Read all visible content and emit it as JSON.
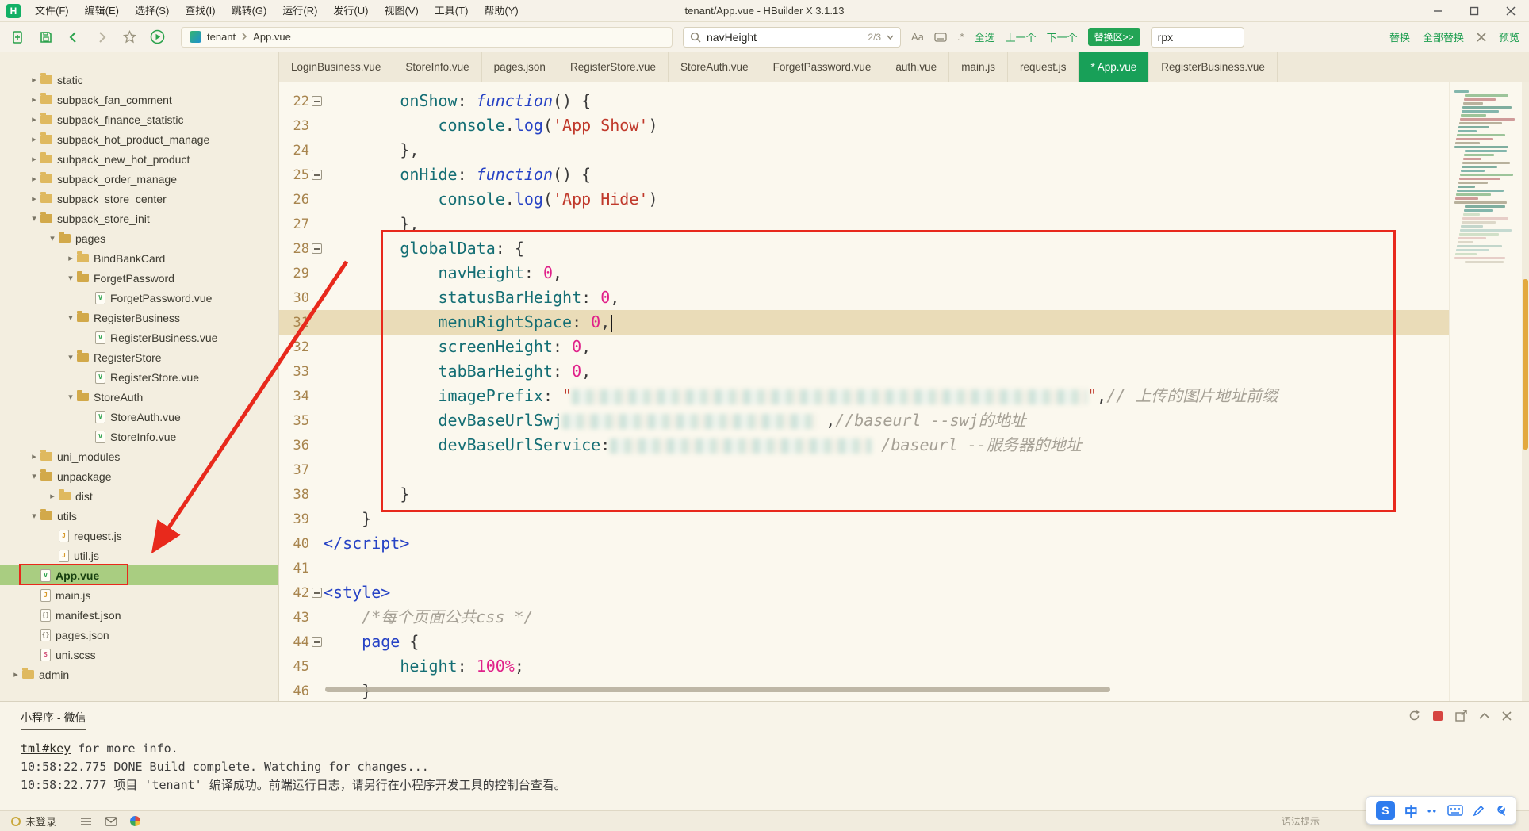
{
  "window": {
    "logo": "H",
    "title": "tenant/App.vue - HBuilder X 3.1.13",
    "menu": [
      "文件(F)",
      "编辑(E)",
      "选择(S)",
      "查找(I)",
      "跳转(G)",
      "运行(R)",
      "发行(U)",
      "视图(V)",
      "工具(T)",
      "帮助(Y)"
    ]
  },
  "toolbar": {
    "breadcrumb": {
      "project": "tenant",
      "file": "App.vue"
    },
    "search": {
      "query": "navHeight",
      "counter": "2/3",
      "match_case": "Aa",
      "regex": ".*",
      "select_all": "全选",
      "prev": "上一个",
      "next": "下一个",
      "replace_zone": "替换区>>",
      "replace_value": "rpx",
      "replace": "替换",
      "replace_all": "全部替换",
      "preview": "预览"
    }
  },
  "tabs": [
    {
      "label": "LoginBusiness.vue",
      "active": false
    },
    {
      "label": "StoreInfo.vue",
      "active": false
    },
    {
      "label": "pages.json",
      "active": false
    },
    {
      "label": "RegisterStore.vue",
      "active": false
    },
    {
      "label": "StoreAuth.vue",
      "active": false
    },
    {
      "label": "ForgetPassword.vue",
      "active": false
    },
    {
      "label": "auth.vue",
      "active": false
    },
    {
      "label": "main.js",
      "active": false
    },
    {
      "label": "request.js",
      "active": false
    },
    {
      "label": "* App.vue",
      "active": true
    },
    {
      "label": "RegisterBusiness.vue",
      "active": false
    }
  ],
  "file_icon_glyphs": {
    "vue": "V",
    "js": "J",
    "json": "{}",
    "scss": "S"
  },
  "file_tree": [
    {
      "label": "static",
      "depth": 1,
      "kind": "folder",
      "state": "closed"
    },
    {
      "label": "subpack_fan_comment",
      "depth": 1,
      "kind": "folder",
      "state": "closed"
    },
    {
      "label": "subpack_finance_statistic",
      "depth": 1,
      "kind": "folder",
      "state": "closed"
    },
    {
      "label": "subpack_hot_product_manage",
      "depth": 1,
      "kind": "folder",
      "state": "closed"
    },
    {
      "label": "subpack_new_hot_product",
      "depth": 1,
      "kind": "folder",
      "state": "closed"
    },
    {
      "label": "subpack_order_manage",
      "depth": 1,
      "kind": "folder",
      "state": "closed"
    },
    {
      "label": "subpack_store_center",
      "depth": 1,
      "kind": "folder",
      "state": "closed"
    },
    {
      "label": "subpack_store_init",
      "depth": 1,
      "kind": "folder",
      "state": "open"
    },
    {
      "label": "pages",
      "depth": 2,
      "kind": "folder",
      "state": "open"
    },
    {
      "label": "BindBankCard",
      "depth": 3,
      "kind": "folder",
      "state": "closed"
    },
    {
      "label": "ForgetPassword",
      "depth": 3,
      "kind": "folder",
      "state": "open"
    },
    {
      "label": "ForgetPassword.vue",
      "depth": 4,
      "kind": "file",
      "ftype": "vue"
    },
    {
      "label": "RegisterBusiness",
      "depth": 3,
      "kind": "folder",
      "state": "open"
    },
    {
      "label": "RegisterBusiness.vue",
      "depth": 4,
      "kind": "file",
      "ftype": "vue"
    },
    {
      "label": "RegisterStore",
      "depth": 3,
      "kind": "folder",
      "state": "open"
    },
    {
      "label": "RegisterStore.vue",
      "depth": 4,
      "kind": "file",
      "ftype": "vue"
    },
    {
      "label": "StoreAuth",
      "depth": 3,
      "kind": "folder",
      "state": "open"
    },
    {
      "label": "StoreAuth.vue",
      "depth": 4,
      "kind": "file",
      "ftype": "vue"
    },
    {
      "label": "StoreInfo.vue",
      "depth": 4,
      "kind": "file",
      "ftype": "vue"
    },
    {
      "label": "uni_modules",
      "depth": 1,
      "kind": "folder",
      "state": "closed"
    },
    {
      "label": "unpackage",
      "depth": 1,
      "kind": "folder",
      "state": "open"
    },
    {
      "label": "dist",
      "depth": 2,
      "kind": "folder",
      "state": "closed"
    },
    {
      "label": "utils",
      "depth": 1,
      "kind": "folder",
      "state": "open"
    },
    {
      "label": "request.js",
      "depth": 2,
      "kind": "file",
      "ftype": "js"
    },
    {
      "label": "util.js",
      "depth": 2,
      "kind": "file",
      "ftype": "js"
    },
    {
      "label": "App.vue",
      "depth": 1,
      "kind": "file",
      "ftype": "vue",
      "selected": true,
      "boxed": true
    },
    {
      "label": "main.js",
      "depth": 1,
      "kind": "file",
      "ftype": "js"
    },
    {
      "label": "manifest.json",
      "depth": 1,
      "kind": "file",
      "ftype": "json"
    },
    {
      "label": "pages.json",
      "depth": 1,
      "kind": "file",
      "ftype": "json"
    },
    {
      "label": "uni.scss",
      "depth": 1,
      "kind": "file",
      "ftype": "scss"
    },
    {
      "label": "admin",
      "depth": 0,
      "kind": "folder",
      "state": "closed"
    }
  ],
  "editor": {
    "lines": [
      {
        "n": 22,
        "fold": true,
        "tokens": [
          [
            "        ",
            "pl"
          ],
          [
            "onShow",
            "prop"
          ],
          [
            ":",
            "pu"
          ],
          [
            " ",
            "pl"
          ],
          [
            "function",
            "kw"
          ],
          [
            "()",
            "pl"
          ],
          [
            " {",
            "pl"
          ]
        ]
      },
      {
        "n": 23,
        "tokens": [
          [
            "            ",
            "pl"
          ],
          [
            "console",
            "prop"
          ],
          [
            ".",
            "pu"
          ],
          [
            "log",
            "fn"
          ],
          [
            "(",
            "pl"
          ],
          [
            "'App Show'",
            "str"
          ],
          [
            ")",
            "pl"
          ]
        ]
      },
      {
        "n": 24,
        "tokens": [
          [
            "        },",
            "pl"
          ]
        ]
      },
      {
        "n": 25,
        "fold": true,
        "tokens": [
          [
            "        ",
            "pl"
          ],
          [
            "onHide",
            "prop"
          ],
          [
            ":",
            "pu"
          ],
          [
            " ",
            "pl"
          ],
          [
            "function",
            "kw"
          ],
          [
            "()",
            "pl"
          ],
          [
            " {",
            "pl"
          ]
        ]
      },
      {
        "n": 26,
        "tokens": [
          [
            "            ",
            "pl"
          ],
          [
            "console",
            "prop"
          ],
          [
            ".",
            "pu"
          ],
          [
            "log",
            "fn"
          ],
          [
            "(",
            "pl"
          ],
          [
            "'App Hide'",
            "str"
          ],
          [
            ")",
            "pl"
          ]
        ]
      },
      {
        "n": 27,
        "tokens": [
          [
            "        },",
            "pl"
          ]
        ]
      },
      {
        "n": 28,
        "fold": true,
        "tokens": [
          [
            "        ",
            "pl"
          ],
          [
            "globalData",
            "prop"
          ],
          [
            ":",
            "pu"
          ],
          [
            " {",
            "pl"
          ]
        ]
      },
      {
        "n": 29,
        "tokens": [
          [
            "            ",
            "pl"
          ],
          [
            "navHeight",
            "prop"
          ],
          [
            ":",
            "pu"
          ],
          [
            " ",
            "pl"
          ],
          [
            "0",
            "num"
          ],
          [
            ",",
            "pl"
          ]
        ]
      },
      {
        "n": 30,
        "tokens": [
          [
            "            ",
            "pl"
          ],
          [
            "statusBarHeight",
            "prop"
          ],
          [
            ":",
            "pu"
          ],
          [
            " ",
            "pl"
          ],
          [
            "0",
            "num"
          ],
          [
            ",",
            "pl"
          ]
        ]
      },
      {
        "n": 31,
        "hl": true,
        "tokens": [
          [
            "            ",
            "pl"
          ],
          [
            "menuRightSpace",
            "prop"
          ],
          [
            ":",
            "pu"
          ],
          [
            " ",
            "pl"
          ],
          [
            "0",
            "num"
          ],
          [
            ",",
            "pl"
          ],
          [
            "",
            "cur"
          ]
        ]
      },
      {
        "n": 32,
        "tokens": [
          [
            "            ",
            "pl"
          ],
          [
            "screenHeight",
            "prop"
          ],
          [
            ":",
            "pu"
          ],
          [
            " ",
            "pl"
          ],
          [
            "0",
            "num"
          ],
          [
            ",",
            "pl"
          ]
        ]
      },
      {
        "n": 33,
        "tokens": [
          [
            "            ",
            "pl"
          ],
          [
            "tabBarHeight",
            "prop"
          ],
          [
            ":",
            "pu"
          ],
          [
            " ",
            "pl"
          ],
          [
            "0",
            "num"
          ],
          [
            ",",
            "pl"
          ]
        ]
      },
      {
        "n": 34,
        "tokens": [
          [
            "            ",
            "pl"
          ],
          [
            "imagePrefix",
            "prop"
          ],
          [
            ":",
            "pu"
          ],
          [
            " ",
            "pl"
          ],
          [
            "\"",
            "str"
          ],
          [
            "",
            "blur",
            650
          ],
          [
            "\"",
            "str"
          ],
          [
            ",",
            "pl"
          ],
          [
            "// 上传的图片地址前缀",
            "cm"
          ]
        ]
      },
      {
        "n": 35,
        "tokens": [
          [
            "            ",
            "pl"
          ],
          [
            "devBaseUrlSwj",
            "prop"
          ],
          [
            "",
            "blur",
            320
          ],
          [
            " ,",
            "pl"
          ],
          [
            "//baseurl --swj的地址",
            "cm"
          ]
        ]
      },
      {
        "n": 36,
        "tokens": [
          [
            "            ",
            "pl"
          ],
          [
            "devBaseUrlService",
            "prop"
          ],
          [
            ":",
            "pu"
          ],
          [
            "",
            "blur",
            330
          ],
          [
            " ",
            "pl"
          ],
          [
            "/baseurl --服务器的地址",
            "cm"
          ]
        ]
      },
      {
        "n": 37,
        "tokens": []
      },
      {
        "n": 38,
        "tokens": [
          [
            "        }",
            "pl"
          ]
        ]
      },
      {
        "n": 39,
        "tokens": [
          [
            "    }",
            "pl"
          ]
        ]
      },
      {
        "n": 40,
        "tokens": [
          [
            "</script>",
            "tag"
          ]
        ]
      },
      {
        "n": 41,
        "tokens": []
      },
      {
        "n": 42,
        "fold": true,
        "tokens": [
          [
            "<style>",
            "tag"
          ]
        ]
      },
      {
        "n": 43,
        "tokens": [
          [
            "    ",
            "pl"
          ],
          [
            "/*每个页面公共css */",
            "cm"
          ]
        ]
      },
      {
        "n": 44,
        "fold": true,
        "tokens": [
          [
            "    ",
            "pl"
          ],
          [
            "page",
            "tag"
          ],
          [
            " {",
            "pl"
          ]
        ]
      },
      {
        "n": 45,
        "tokens": [
          [
            "        ",
            "pl"
          ],
          [
            "height",
            "prop"
          ],
          [
            ":",
            "pu"
          ],
          [
            " ",
            "pl"
          ],
          [
            "100%",
            "num"
          ],
          [
            ";",
            "pl"
          ]
        ]
      },
      {
        "n": 46,
        "tokens": [
          [
            "    }",
            "pl"
          ]
        ]
      }
    ]
  },
  "console": {
    "tab": "小程序 - 微信",
    "lines": [
      [
        {
          "t": "tml#key",
          "link": true
        },
        {
          "t": " for more info."
        }
      ],
      [
        {
          "t": "10:58:22.775  DONE  Build complete. Watching for changes..."
        }
      ],
      [
        {
          "t": "10:58:22.777 项目 'tenant' 编译成功。前端运行日志，请另行在小程序开发工具的控制台查看。"
        }
      ]
    ]
  },
  "status_bar": {
    "login": "未登录",
    "hint": "语法提示"
  },
  "ime": {
    "brand": "S",
    "lang": "中",
    "dots": "••"
  }
}
